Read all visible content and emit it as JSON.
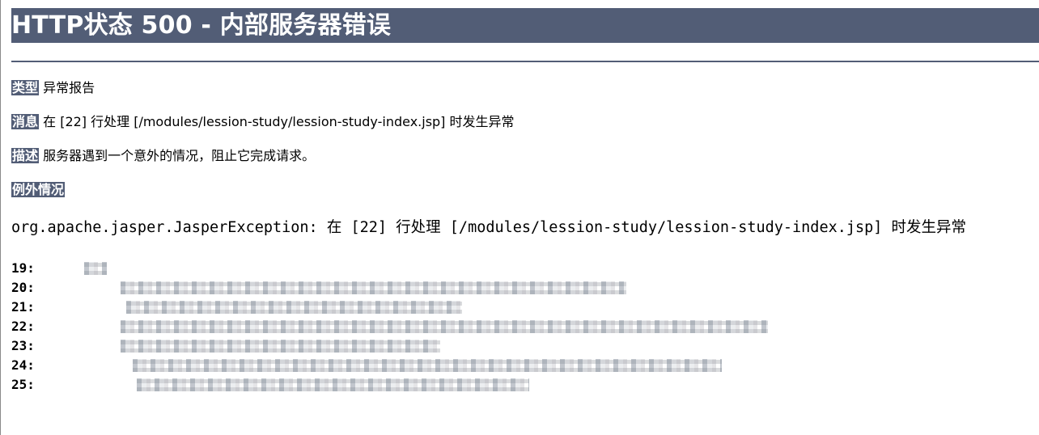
{
  "title": "HTTP状态 500 - 内部服务器错误",
  "fields": {
    "type": {
      "label": "类型",
      "value": "异常报告"
    },
    "message": {
      "label": "消息",
      "value": "在 [22] 行处理 [/modules/lession-study/lession-study-index.jsp] 时发生异常"
    },
    "description": {
      "label": "描述",
      "value": "服务器遇到一个意外的情况，阻止它完成请求。"
    },
    "exception": {
      "label": "例外情况"
    }
  },
  "exception_text": "org.apache.jasper.JasperException: 在 [22] 行处理 [/modules/lession-study/lession-study-index.jsp] 时发生异常",
  "code_lines": [
    "19:",
    "20:",
    "21:",
    "22:",
    "23:",
    "24:",
    "25:"
  ]
}
